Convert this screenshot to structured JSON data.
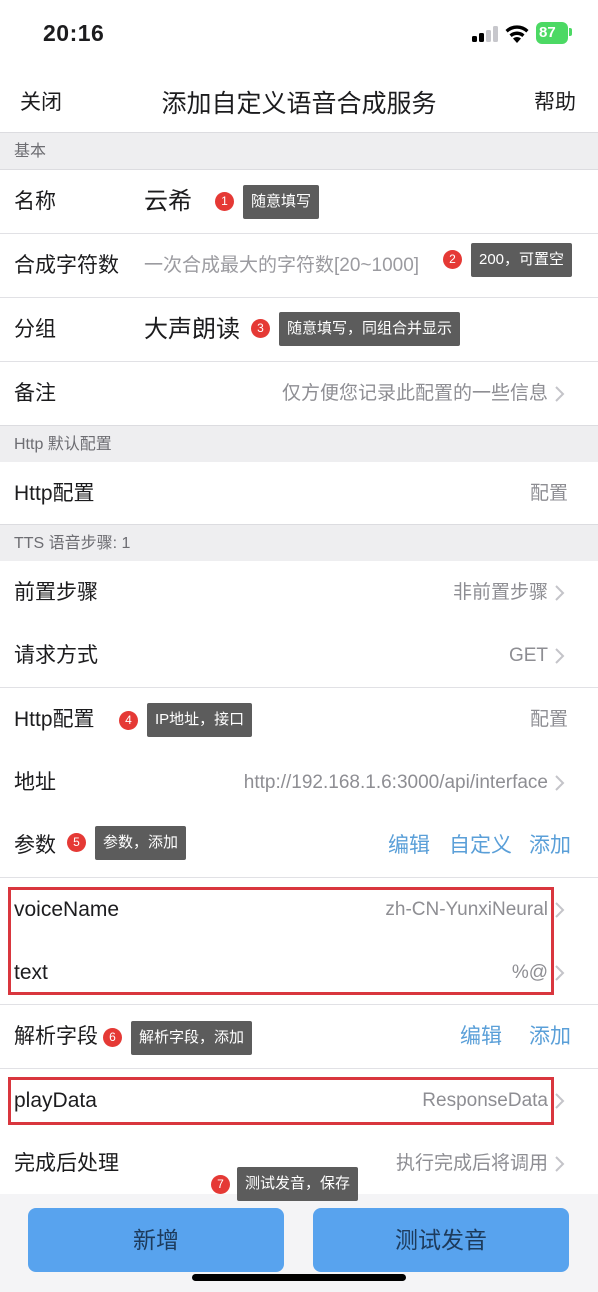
{
  "status": {
    "time": "20:16",
    "battery": "87"
  },
  "nav": {
    "close": "关闭",
    "title": "添加自定义语音合成服务",
    "help": "帮助"
  },
  "sections": {
    "basic": "基本",
    "http_default": "Http 默认配置",
    "tts_steps": "TTS 语音步骤: 1"
  },
  "basic": {
    "name_label": "名称",
    "name_value": "云希",
    "chars_label": "合成字符数",
    "chars_placeholder": "一次合成最大的字符数[20~1000]",
    "group_label": "分组",
    "group_value": "大声朗读",
    "note_label": "备注",
    "note_placeholder": "仅方便您记录此配置的一些信息"
  },
  "http_default": {
    "label": "Http配置",
    "value": "配置"
  },
  "steps": {
    "pre_label": "前置步骤",
    "pre_value": "非前置步骤",
    "method_label": "请求方式",
    "method_value": "GET",
    "http_label": "Http配置",
    "http_value": "配置",
    "url_label": "地址",
    "url_value": "http://192.168.1.6:3000/api/interface",
    "params_label": "参数",
    "params_edit": "编辑",
    "params_custom": "自定义",
    "params_add": "添加",
    "params": [
      {
        "key": "voiceName",
        "value": "zh-CN-YunxiNeural"
      },
      {
        "key": "text",
        "value": "%@"
      }
    ],
    "parse_label": "解析字段",
    "parse_edit": "编辑",
    "parse_add": "添加",
    "parse_fields": [
      {
        "key": "playData",
        "value": "ResponseData"
      }
    ],
    "post_label": "完成后处理",
    "post_value": "执行完成后将调用"
  },
  "annotations": [
    {
      "num": "1",
      "text": "随意填写"
    },
    {
      "num": "2",
      "text": "200，可置空"
    },
    {
      "num": "3",
      "text": "随意填写，同组合并显示"
    },
    {
      "num": "4",
      "text": "IP地址，接口"
    },
    {
      "num": "5",
      "text": "参数，添加"
    },
    {
      "num": "6",
      "text": "解析字段，添加"
    },
    {
      "num": "7",
      "text": "测试发音，保存"
    }
  ],
  "buttons": {
    "add": "新增",
    "test": "测试发音"
  },
  "colors": {
    "accent": "#58a3ee",
    "link": "#5a9fd8",
    "badge": "#e53935",
    "highlight": "#d9363e",
    "tooltip": "#5c5c5c"
  }
}
